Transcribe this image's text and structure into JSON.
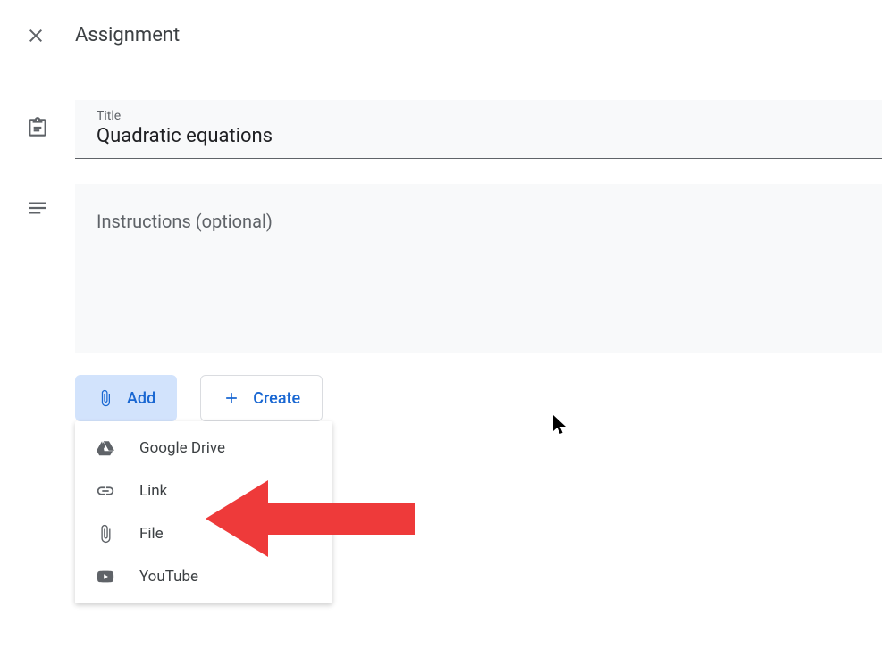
{
  "header": {
    "title": "Assignment"
  },
  "title_field": {
    "label": "Title",
    "value": "Quadratic equations"
  },
  "instructions_field": {
    "placeholder": "Instructions (optional)",
    "value": ""
  },
  "buttons": {
    "add": "Add",
    "create": "Create"
  },
  "add_menu": {
    "items": [
      {
        "icon": "drive-icon",
        "label": "Google Drive"
      },
      {
        "icon": "link-icon",
        "label": "Link"
      },
      {
        "icon": "file-icon",
        "label": "File"
      },
      {
        "icon": "youtube-icon",
        "label": "YouTube"
      }
    ]
  }
}
